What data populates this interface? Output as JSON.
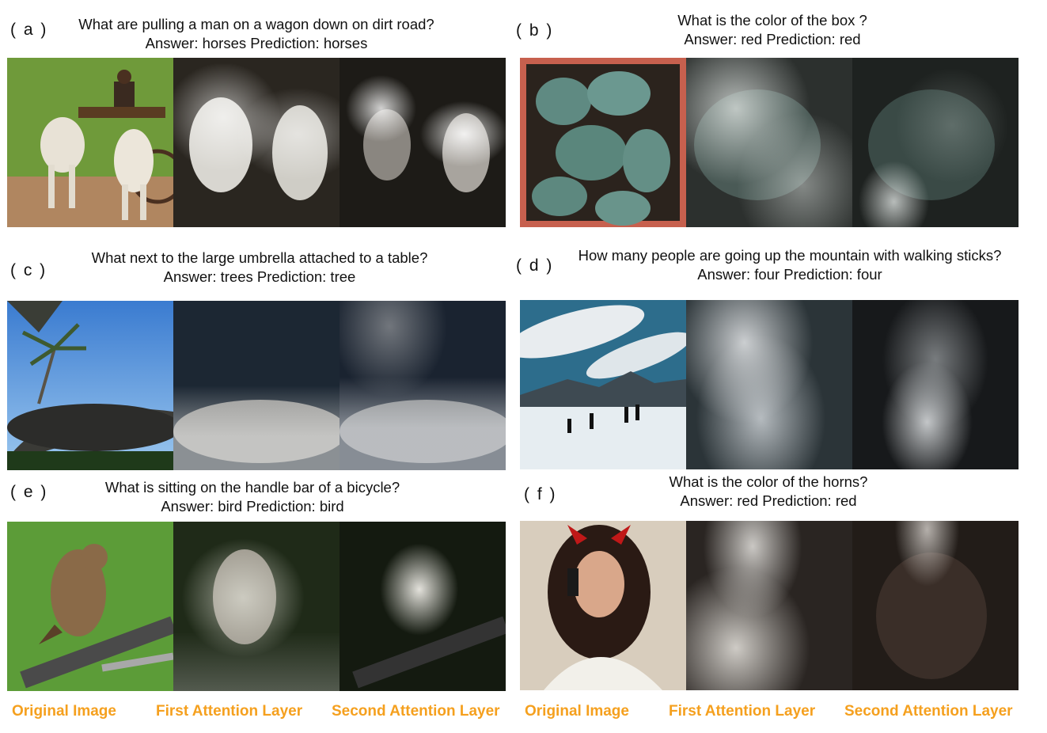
{
  "panels": [
    {
      "label": "( a )",
      "question": "What are pulling a man  on a wagon down on dirt road?",
      "answer_line": "Answer: horses      Prediction: horses"
    },
    {
      "label": "( b )",
      "question": "What is the color of the box ?",
      "answer_line": "Answer: red  Prediction: red"
    },
    {
      "label": "( c )",
      "question": "What next to the large umbrella attached to a table?",
      "answer_line": "Answer: trees  Prediction: tree"
    },
    {
      "label": "( d )",
      "question": "How many people are going up the mountain with walking sticks?",
      "answer_line": "Answer: four  Prediction: four"
    },
    {
      "label": "( e )",
      "question": "What is sitting on the  handle bar of a bicycle?",
      "answer_line": "Answer: bird Prediction: bird"
    },
    {
      "label": "( f )",
      "question": "What is the color of the horns?",
      "answer_line": "Answer: red Prediction: red"
    }
  ],
  "footer": {
    "left": [
      "Original Image",
      "First Attention Layer",
      "Second Attention Layer"
    ],
    "right": [
      "Original Image",
      "First Attention Layer",
      "Second Attention Layer"
    ]
  },
  "colors": {
    "caption": "#f5a01e"
  }
}
